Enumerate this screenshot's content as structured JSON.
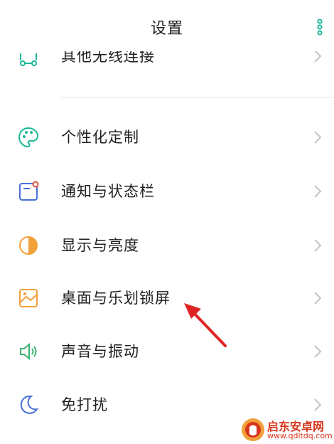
{
  "header": {
    "title": "设置",
    "menu_icon": "more-vertical-icon",
    "accent_color": "#1bb89a"
  },
  "settings": {
    "items": [
      {
        "label": "其他无线连接",
        "icon": "wireless-connection-icon",
        "color": "#1bb89a"
      },
      {
        "label": "个性化定制",
        "icon": "palette-icon",
        "color": "#1bb89a"
      },
      {
        "label": "通知与状态栏",
        "icon": "notification-icon",
        "color": "#4a6fd8"
      },
      {
        "label": "显示与亮度",
        "icon": "brightness-icon",
        "color": "#f2a03a"
      },
      {
        "label": "桌面与乐划锁屏",
        "icon": "wallpaper-icon",
        "color": "#f2a03a"
      },
      {
        "label": "声音与振动",
        "icon": "speaker-icon",
        "color": "#3cb371"
      },
      {
        "label": "免打扰",
        "icon": "moon-icon",
        "color": "#4a6fd8"
      }
    ]
  },
  "annotation": {
    "arrow_color": "#e02424"
  },
  "watermark": {
    "name": "启东安卓网",
    "url": "www.qdltdq.com",
    "color": "#d8341c"
  }
}
